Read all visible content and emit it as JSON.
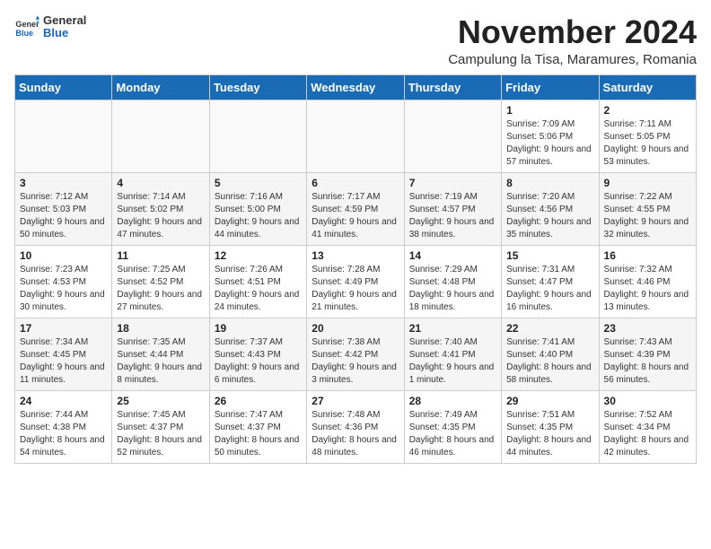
{
  "header": {
    "logo_general": "General",
    "logo_blue": "Blue",
    "month_title": "November 2024",
    "subtitle": "Campulung la Tisa, Maramures, Romania"
  },
  "days_of_week": [
    "Sunday",
    "Monday",
    "Tuesday",
    "Wednesday",
    "Thursday",
    "Friday",
    "Saturday"
  ],
  "weeks": [
    [
      {
        "day": "",
        "empty": true
      },
      {
        "day": "",
        "empty": true
      },
      {
        "day": "",
        "empty": true
      },
      {
        "day": "",
        "empty": true
      },
      {
        "day": "",
        "empty": true
      },
      {
        "day": "1",
        "sunrise": "7:09 AM",
        "sunset": "5:06 PM",
        "daylight": "9 hours and 57 minutes."
      },
      {
        "day": "2",
        "sunrise": "7:11 AM",
        "sunset": "5:05 PM",
        "daylight": "9 hours and 53 minutes."
      }
    ],
    [
      {
        "day": "3",
        "sunrise": "7:12 AM",
        "sunset": "5:03 PM",
        "daylight": "9 hours and 50 minutes."
      },
      {
        "day": "4",
        "sunrise": "7:14 AM",
        "sunset": "5:02 PM",
        "daylight": "9 hours and 47 minutes."
      },
      {
        "day": "5",
        "sunrise": "7:16 AM",
        "sunset": "5:00 PM",
        "daylight": "9 hours and 44 minutes."
      },
      {
        "day": "6",
        "sunrise": "7:17 AM",
        "sunset": "4:59 PM",
        "daylight": "9 hours and 41 minutes."
      },
      {
        "day": "7",
        "sunrise": "7:19 AM",
        "sunset": "4:57 PM",
        "daylight": "9 hours and 38 minutes."
      },
      {
        "day": "8",
        "sunrise": "7:20 AM",
        "sunset": "4:56 PM",
        "daylight": "9 hours and 35 minutes."
      },
      {
        "day": "9",
        "sunrise": "7:22 AM",
        "sunset": "4:55 PM",
        "daylight": "9 hours and 32 minutes."
      }
    ],
    [
      {
        "day": "10",
        "sunrise": "7:23 AM",
        "sunset": "4:53 PM",
        "daylight": "9 hours and 30 minutes."
      },
      {
        "day": "11",
        "sunrise": "7:25 AM",
        "sunset": "4:52 PM",
        "daylight": "9 hours and 27 minutes."
      },
      {
        "day": "12",
        "sunrise": "7:26 AM",
        "sunset": "4:51 PM",
        "daylight": "9 hours and 24 minutes."
      },
      {
        "day": "13",
        "sunrise": "7:28 AM",
        "sunset": "4:49 PM",
        "daylight": "9 hours and 21 minutes."
      },
      {
        "day": "14",
        "sunrise": "7:29 AM",
        "sunset": "4:48 PM",
        "daylight": "9 hours and 18 minutes."
      },
      {
        "day": "15",
        "sunrise": "7:31 AM",
        "sunset": "4:47 PM",
        "daylight": "9 hours and 16 minutes."
      },
      {
        "day": "16",
        "sunrise": "7:32 AM",
        "sunset": "4:46 PM",
        "daylight": "9 hours and 13 minutes."
      }
    ],
    [
      {
        "day": "17",
        "sunrise": "7:34 AM",
        "sunset": "4:45 PM",
        "daylight": "9 hours and 11 minutes."
      },
      {
        "day": "18",
        "sunrise": "7:35 AM",
        "sunset": "4:44 PM",
        "daylight": "9 hours and 8 minutes."
      },
      {
        "day": "19",
        "sunrise": "7:37 AM",
        "sunset": "4:43 PM",
        "daylight": "9 hours and 6 minutes."
      },
      {
        "day": "20",
        "sunrise": "7:38 AM",
        "sunset": "4:42 PM",
        "daylight": "9 hours and 3 minutes."
      },
      {
        "day": "21",
        "sunrise": "7:40 AM",
        "sunset": "4:41 PM",
        "daylight": "9 hours and 1 minute."
      },
      {
        "day": "22",
        "sunrise": "7:41 AM",
        "sunset": "4:40 PM",
        "daylight": "8 hours and 58 minutes."
      },
      {
        "day": "23",
        "sunrise": "7:43 AM",
        "sunset": "4:39 PM",
        "daylight": "8 hours and 56 minutes."
      }
    ],
    [
      {
        "day": "24",
        "sunrise": "7:44 AM",
        "sunset": "4:38 PM",
        "daylight": "8 hours and 54 minutes."
      },
      {
        "day": "25",
        "sunrise": "7:45 AM",
        "sunset": "4:37 PM",
        "daylight": "8 hours and 52 minutes."
      },
      {
        "day": "26",
        "sunrise": "7:47 AM",
        "sunset": "4:37 PM",
        "daylight": "8 hours and 50 minutes."
      },
      {
        "day": "27",
        "sunrise": "7:48 AM",
        "sunset": "4:36 PM",
        "daylight": "8 hours and 48 minutes."
      },
      {
        "day": "28",
        "sunrise": "7:49 AM",
        "sunset": "4:35 PM",
        "daylight": "8 hours and 46 minutes."
      },
      {
        "day": "29",
        "sunrise": "7:51 AM",
        "sunset": "4:35 PM",
        "daylight": "8 hours and 44 minutes."
      },
      {
        "day": "30",
        "sunrise": "7:52 AM",
        "sunset": "4:34 PM",
        "daylight": "8 hours and 42 minutes."
      }
    ]
  ]
}
